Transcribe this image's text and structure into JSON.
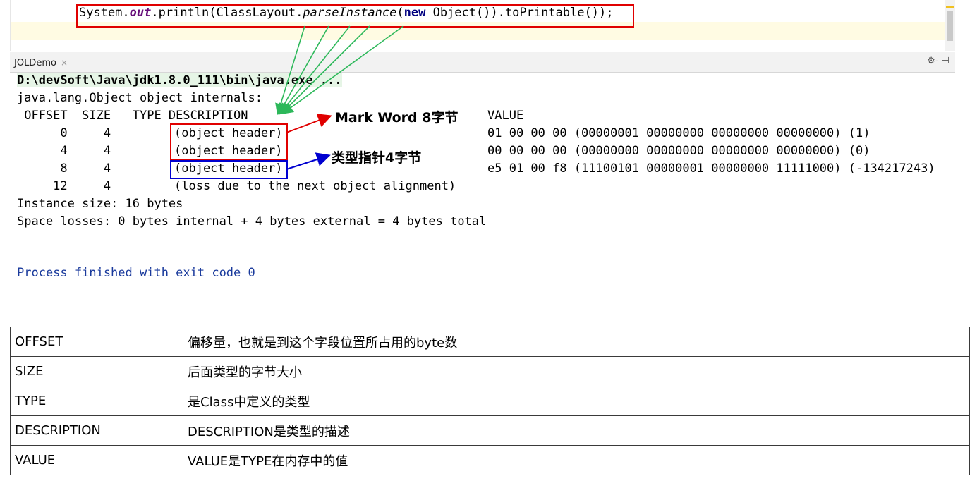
{
  "editor": {
    "code": {
      "part1": "System.",
      "out": "out",
      "part2": ".println(ClassLayout.",
      "parse": "parseInstance",
      "part3": "(",
      "new": "new",
      "part4": " Object()).toPrintable());"
    }
  },
  "run_panel": {
    "tab_label": "JOLDemo",
    "tab_close": "×",
    "tools": "⚙- ⊣",
    "command": "D:\\devSoft\\Java\\jdk1.8.0_111\\bin\\java.exe ...",
    "header_line": "java.lang.Object object internals:",
    "columns": " OFFSET  SIZE   TYPE DESCRIPTION",
    "value_header": "VALUE",
    "rows": [
      {
        "offset_size": "      0     4",
        "desc": "(object header)",
        "value": "01 00 00 00 (00000001 00000000 00000000 00000000) (1)"
      },
      {
        "offset_size": "      4     4",
        "desc": "(object header)",
        "value": "00 00 00 00 (00000000 00000000 00000000 00000000) (0)"
      },
      {
        "offset_size": "      8     4",
        "desc": "(object header)",
        "value": "e5 01 00 f8 (11100101 00000001 00000000 11111000) (-134217243)"
      },
      {
        "offset_size": "     12     4",
        "desc": "(loss due to the next object alignment)",
        "value": ""
      }
    ],
    "instance_size": "Instance size: 16 bytes",
    "space_losses": "Space losses: 0 bytes internal + 4 bytes external = 4 bytes total",
    "process_finished": "Process finished with exit code 0"
  },
  "annotations": {
    "mark_word": "Mark Word 8字节",
    "klass_pointer": "类型指针4字节"
  },
  "colors": {
    "red_box": "#e00000",
    "blue_box": "#0000d0",
    "green_arrow": "#2db85a"
  },
  "table": {
    "rows": [
      {
        "key": "OFFSET",
        "desc": "偏移量，也就是到这个字段位置所占用的byte数"
      },
      {
        "key": "SIZE",
        "desc": "后面类型的字节大小"
      },
      {
        "key": "TYPE",
        "desc": "是Class中定义的类型"
      },
      {
        "key": "DESCRIPTION",
        "desc": "DESCRIPTION是类型的描述"
      },
      {
        "key": "VALUE",
        "desc": "VALUE是TYPE在内存中的值"
      }
    ]
  }
}
